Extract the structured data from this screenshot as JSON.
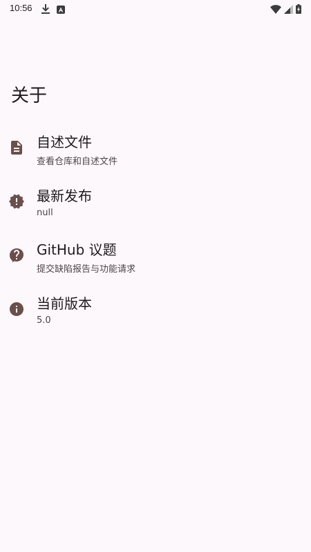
{
  "status_bar": {
    "time": "10:56",
    "left_icons": [
      "download-icon",
      "app-notification-icon"
    ],
    "right_icons": [
      "wifi-icon",
      "signal-icon",
      "battery-icon"
    ]
  },
  "page": {
    "title": "关于"
  },
  "items": [
    {
      "title": "自述文件",
      "subtitle": "查看仓库和自述文件",
      "icon": "document-icon"
    },
    {
      "title": "最新发布",
      "subtitle": "null",
      "icon": "new-release-icon"
    },
    {
      "title": "GitHub 议题",
      "subtitle": "提交缺陷报告与功能请求",
      "icon": "help-icon"
    },
    {
      "title": "当前版本",
      "subtitle": "5.0",
      "icon": "info-icon"
    }
  ],
  "colors": {
    "background": "#fdf8fc",
    "icon": "#6b4f4a",
    "title_text": "#1f1a1d",
    "subtitle_text": "#4e4448"
  }
}
